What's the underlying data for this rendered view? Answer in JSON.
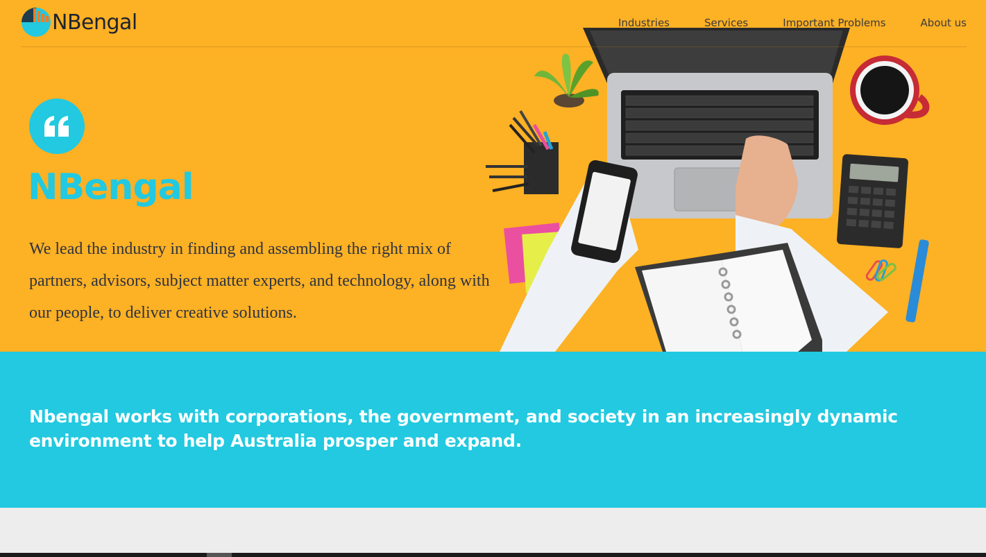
{
  "brand": {
    "logo_text": "NBengal",
    "colors": {
      "primary": "#22c9e0",
      "accent": "#fdb124",
      "dark": "#1d2330",
      "orange": "#f47a1f"
    }
  },
  "nav": {
    "items": [
      {
        "label": "Industries"
      },
      {
        "label": "Services"
      },
      {
        "label": "Important Problems"
      },
      {
        "label": "About us"
      }
    ]
  },
  "hero": {
    "icon": "quote-icon",
    "title": "NBengal",
    "description": "We lead the industry in finding and assembling the right mix of partners, advisors, subject matter experts, and technology, along with our people, to deliver creative solutions.",
    "image": "desk-workspace-illustration"
  },
  "band": {
    "headline": "Nbengal works with corporations, the government, and society in an increasingly dynamic environment to help Australia prosper and expand."
  }
}
